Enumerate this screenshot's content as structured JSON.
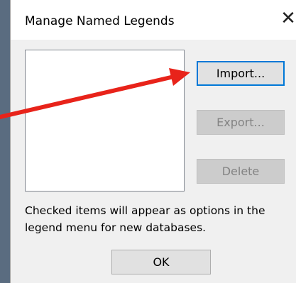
{
  "dialog": {
    "title": "Manage Named Legends",
    "close_glyph": "✕",
    "list_items": [],
    "buttons": {
      "import": "Import...",
      "export": "Export...",
      "delete": "Delete",
      "ok": "OK"
    },
    "info_text": "Checked items will appear as options in the legend menu for new databases."
  },
  "annotation": {
    "type": "arrow",
    "color": "#e8231a",
    "target": "import-button"
  },
  "icons": [
    "close-icon"
  ]
}
